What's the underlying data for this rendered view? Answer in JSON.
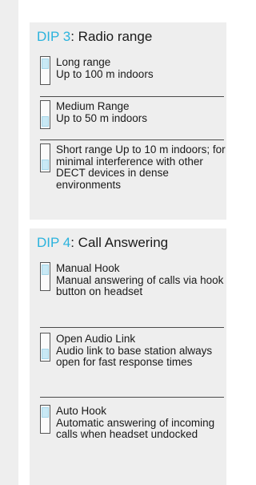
{
  "dip3": {
    "label": "DIP 3",
    "separator": ":",
    "title": " Radio range",
    "options": [
      {
        "title": "Long range",
        "description": "Up to 100 m indoors",
        "switch": "up"
      },
      {
        "title": "Medium Range",
        "description": "Up to 50 m indoors",
        "switch": "down"
      },
      {
        "title": "Short range",
        "description": " Up to 10 m indoors; for minimal interference with other DECT devices in dense environments",
        "switch": "down"
      }
    ]
  },
  "dip4": {
    "label": "DIP 4",
    "separator": ":",
    "title": " Call Answering",
    "options": [
      {
        "title": "Manual Hook",
        "description": "Manual answering of calls via hook button on headset",
        "switch": "up"
      },
      {
        "title": "Open Audio Link",
        "description": "Audio link to base station always open for fast response times",
        "switch": "down"
      },
      {
        "title": "Auto Hook",
        "description": "Automatic answering of incoming calls when headset undocked",
        "switch": "up"
      }
    ]
  },
  "colors": {
    "accent": "#2bb3dd",
    "panel_bg": "#eeeeee",
    "switch_knob": "#c9e9f5"
  }
}
